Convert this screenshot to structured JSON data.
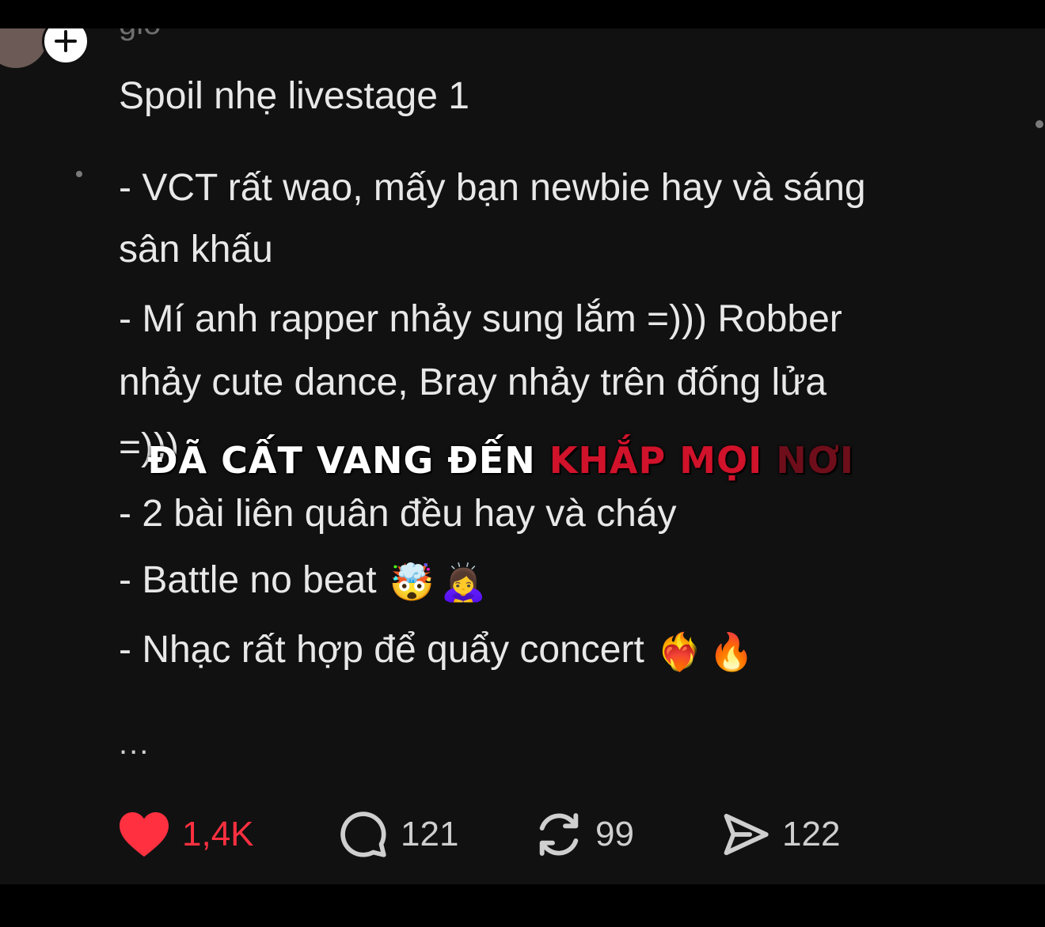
{
  "post": {
    "username": "gio",
    "title": "Spoil nhẹ livestage 1",
    "lines": [
      "- VCT rất wao, mấy bạn newbie hay và sáng",
      "sân khấu",
      "- Mí anh rapper nhảy sung lắm =))) Robber",
      "nhảy cute dance, Bray nhảy trên đống lửa",
      "=)))",
      "- 2 bài liên quân đều hay và cháy",
      "- Battle no beat",
      "- Nhạc rất hợp để quẩy concert"
    ],
    "line_emojis": {
      "battle": [
        "🤯",
        "🙇‍♀️"
      ],
      "concert": [
        "❤️‍🔥",
        "🔥"
      ]
    },
    "ellipsis": "..."
  },
  "overlay_caption": {
    "white": "ĐÃ CẤT VANG ĐẾN",
    "red": "KHẮP MỌI",
    "dark_red": "NƠI"
  },
  "actions": {
    "like_count": "1,4K",
    "comment_count": "121",
    "repost_count": "99",
    "share_count": "122"
  },
  "icons": [
    "plus-icon",
    "heart-icon",
    "comment-icon",
    "repost-icon",
    "share-icon"
  ],
  "colors": {
    "background": "#111111",
    "text": "#e8e8e8",
    "like": "#ff3040",
    "caption_red": "#d0122a"
  }
}
